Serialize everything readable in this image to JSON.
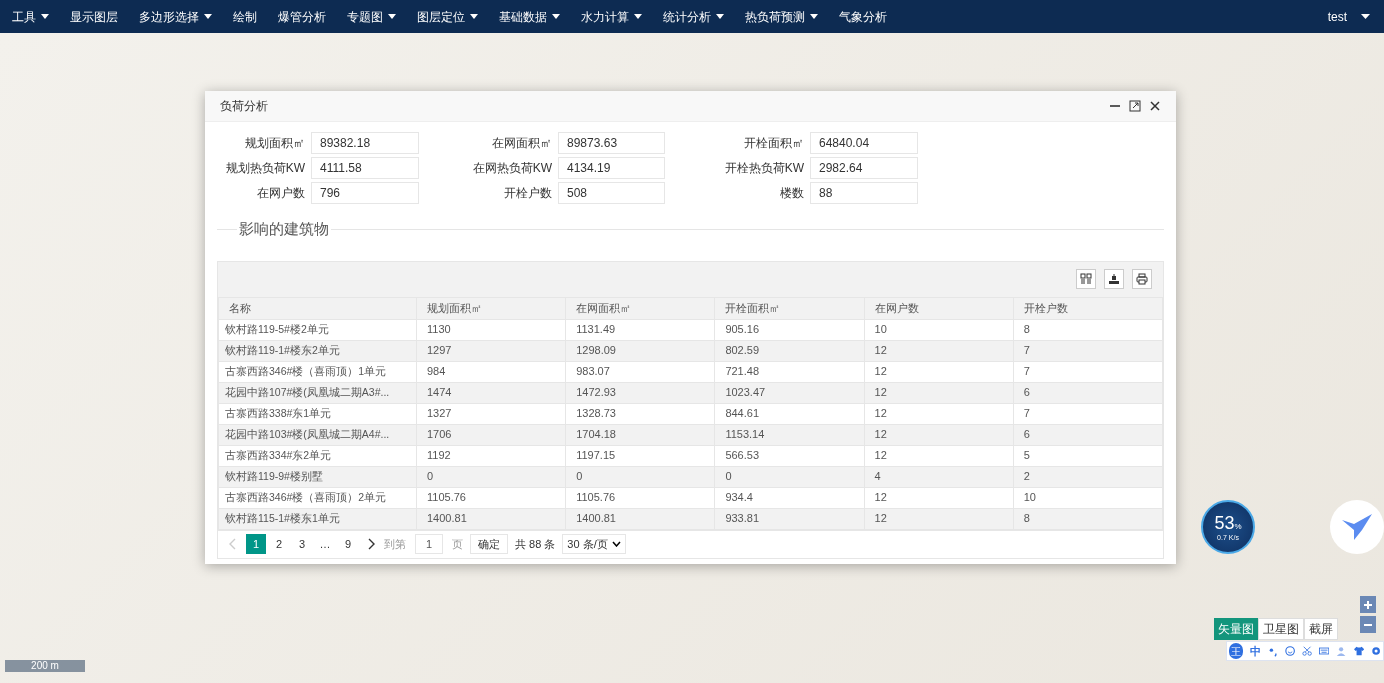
{
  "navbar": {
    "menus": [
      {
        "label": "工具",
        "dropdown": true
      },
      {
        "label": "显示图层",
        "dropdown": false
      },
      {
        "label": "多边形选择",
        "dropdown": true
      },
      {
        "label": "绘制",
        "dropdown": false
      },
      {
        "label": "爆管分析",
        "dropdown": false
      },
      {
        "label": "专题图",
        "dropdown": true
      },
      {
        "label": "图层定位",
        "dropdown": true
      },
      {
        "label": "基础数据",
        "dropdown": true
      },
      {
        "label": "水力计算",
        "dropdown": true
      },
      {
        "label": "统计分析",
        "dropdown": true
      },
      {
        "label": "热负荷预测",
        "dropdown": true
      },
      {
        "label": "气象分析",
        "dropdown": false
      }
    ],
    "user": "test"
  },
  "map": {
    "scale": "200 m",
    "map_types": [
      {
        "label": "矢量图",
        "selected": true
      },
      {
        "label": "卫星图",
        "selected": false
      },
      {
        "label": "截屏",
        "selected": false
      }
    ]
  },
  "speed_widget": {
    "percent": "53",
    "unit": "%",
    "speed": "0.7 K/s"
  },
  "ime_toolbar": {
    "logo": "王",
    "mode": "中"
  },
  "dialog": {
    "title": "负荷分析",
    "fields": [
      {
        "label": "规划面积㎡",
        "value": "89382.18"
      },
      {
        "label": "在网面积㎡",
        "value": "89873.63"
      },
      {
        "label": "开栓面积㎡",
        "value": "64840.04"
      },
      {
        "label": "规划热负荷KW",
        "value": "4111.58"
      },
      {
        "label": "在网热负荷KW",
        "value": "4134.19"
      },
      {
        "label": "开栓热负荷KW",
        "value": "2982.64"
      },
      {
        "label": "在网户数",
        "value": "796"
      },
      {
        "label": "开栓户数",
        "value": "508"
      },
      {
        "label": "楼数",
        "value": "88"
      }
    ],
    "section_title": "影响的建筑物",
    "table": {
      "columns": [
        "名称",
        "规划面积㎡",
        "在网面积㎡",
        "开栓面积㎡",
        "在网户数",
        "开栓户数"
      ],
      "rows": [
        [
          "钦村路119-5#楼2单元",
          "1130",
          "1131.49",
          "905.16",
          "10",
          "8"
        ],
        [
          "钦村路119-1#楼东2单元",
          "1297",
          "1298.09",
          "802.59",
          "12",
          "7"
        ],
        [
          "古寨西路346#楼（喜雨顶）1单元",
          "984",
          "983.07",
          "721.48",
          "12",
          "7"
        ],
        [
          "花园中路107#楼(凤凰城二期A3#...",
          "1474",
          "1472.93",
          "1023.47",
          "12",
          "6"
        ],
        [
          "古寨西路338#东1单元",
          "1327",
          "1328.73",
          "844.61",
          "12",
          "7"
        ],
        [
          "花园中路103#楼(凤凰城二期A4#...",
          "1706",
          "1704.18",
          "1153.14",
          "12",
          "6"
        ],
        [
          "古寨西路334#东2单元",
          "1192",
          "1197.15",
          "566.53",
          "12",
          "5"
        ],
        [
          "钦村路119-9#楼别墅",
          "0",
          "0",
          "0",
          "4",
          "2"
        ],
        [
          "古寨西路346#楼（喜雨顶）2单元",
          "1105.76",
          "1105.76",
          "934.4",
          "12",
          "10"
        ],
        [
          "钦村路115-1#楼东1单元",
          "1400.81",
          "1400.81",
          "933.81",
          "12",
          "8"
        ]
      ]
    },
    "pagination": {
      "pages": [
        {
          "label": "1",
          "selected": true
        },
        {
          "label": "2",
          "selected": false
        },
        {
          "label": "3",
          "selected": false
        },
        {
          "label": "…",
          "selected": false
        },
        {
          "label": "9",
          "selected": false
        }
      ],
      "goto_label": "到第",
      "goto_value": "1",
      "page_unit": "页",
      "confirm": "确定",
      "total": "共 88 条",
      "page_size": "30 条/页"
    }
  }
}
